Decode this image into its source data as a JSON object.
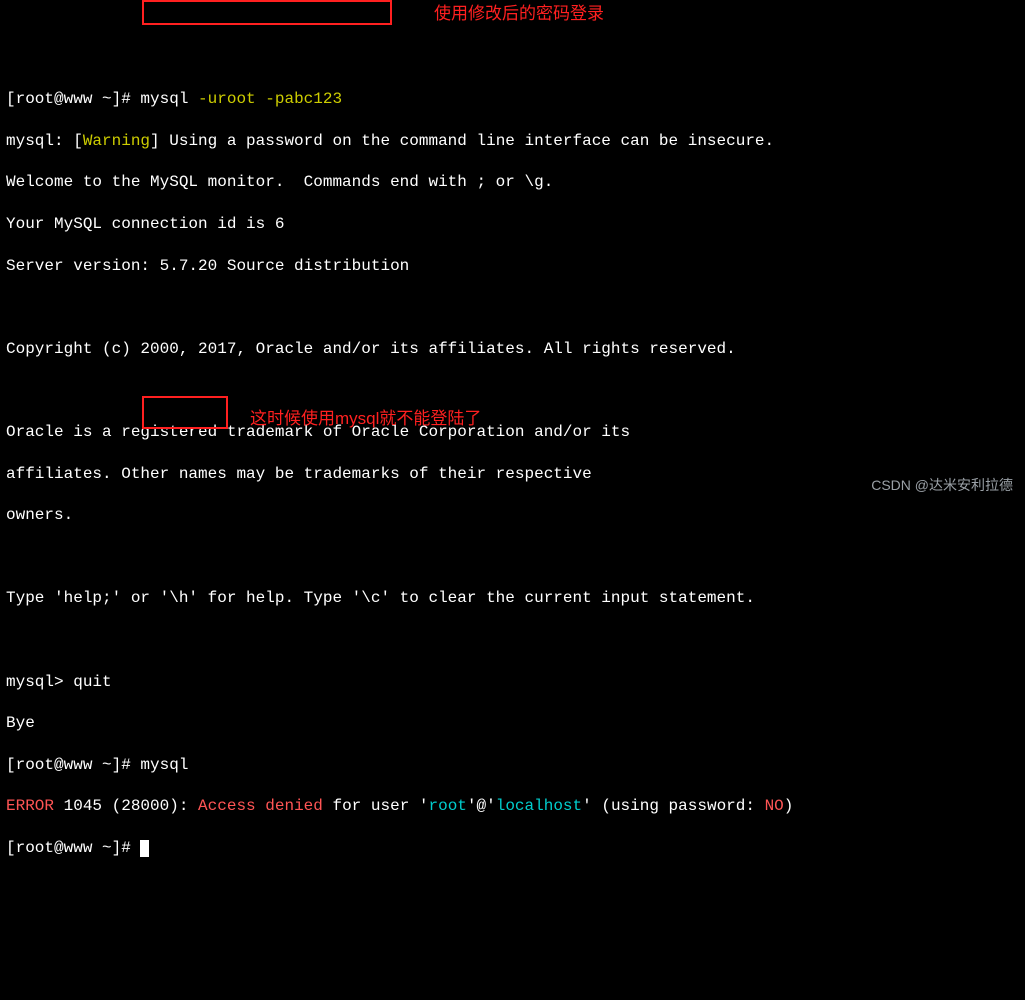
{
  "terminal": {
    "prompt1": "[root@www ~]#",
    "cmd1a": " mysql ",
    "cmd1b": "-uroot -pabc123",
    "line2a": "mysql: [",
    "line2b": "Warning",
    "line2c": "] Using a password on the command line interface can be insecure.",
    "line3": "Welcome to the MySQL monitor.  Commands end with ; or \\g.",
    "line4": "Your MySQL connection id is 6",
    "line5": "Server version: 5.7.20 Source distribution",
    "line6": " ",
    "line7": "Copyright (c) 2000, 2017, Oracle and/or its affiliates. All rights reserved.",
    "line8": " ",
    "line9": "Oracle is a registered trademark of Oracle Corporation and/or its",
    "line10": "affiliates. Other names may be trademarks of their respective",
    "line11": "owners.",
    "line12": " ",
    "line13": "Type 'help;' or '\\h' for help. Type '\\c' to clear the current input statement.",
    "line14": " ",
    "line15": "mysql> quit",
    "line16": "Bye",
    "prompt2": "[root@www ~]#",
    "cmd2": " mysql",
    "err_a": "ERROR",
    "err_b": " 1045 (28000): ",
    "err_c": "Access denied",
    "err_d": " for user '",
    "err_e": "root",
    "err_f": "'@'",
    "err_g": "localhost",
    "err_h": "' (using password: ",
    "err_i": "NO",
    "err_j": ")",
    "prompt3": "[root@www ~]# "
  },
  "annotations": {
    "note1": "使用修改后的密码登录",
    "note2": "这时候使用mysql就不能登陆了"
  },
  "attribution": "CSDN @达米安利拉德"
}
